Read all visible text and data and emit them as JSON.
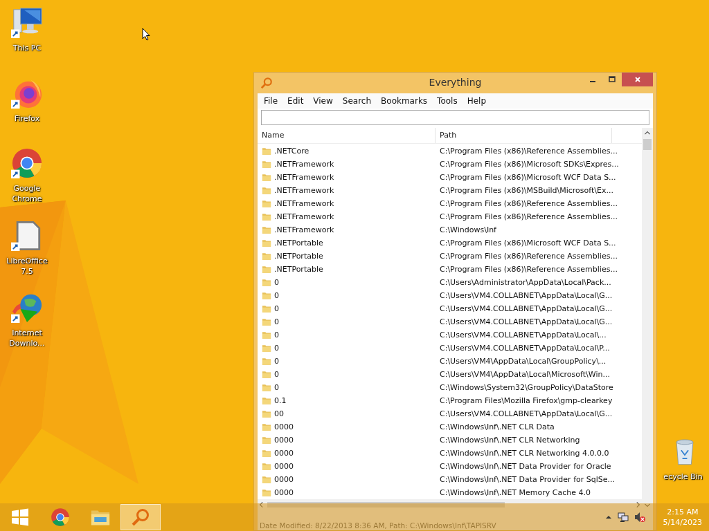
{
  "desktop_icons": [
    {
      "label": "This PC",
      "kind": "pc"
    },
    {
      "label": "Firefox",
      "kind": "firefox"
    },
    {
      "label": "Google Chrome",
      "kind": "chrome"
    },
    {
      "label": "LibreOffice 7.5",
      "kind": "libreoffice"
    },
    {
      "label": "Internet Downlo...",
      "kind": "idm"
    }
  ],
  "recycle_bin": {
    "label": "ecycle Bin"
  },
  "window": {
    "title": "Everything",
    "menu": [
      "File",
      "Edit",
      "View",
      "Search",
      "Bookmarks",
      "Tools",
      "Help"
    ],
    "columns": [
      "Name",
      "Path"
    ],
    "rows": [
      {
        "name": ".NETCore",
        "path": "C:\\Program Files (x86)\\Reference Assemblies..."
      },
      {
        "name": ".NETFramework",
        "path": "C:\\Program Files (x86)\\Microsoft SDKs\\Expres..."
      },
      {
        "name": ".NETFramework",
        "path": "C:\\Program Files (x86)\\Microsoft WCF Data S..."
      },
      {
        "name": ".NETFramework",
        "path": "C:\\Program Files (x86)\\MSBuild\\Microsoft\\Ex..."
      },
      {
        "name": ".NETFramework",
        "path": "C:\\Program Files (x86)\\Reference Assemblies..."
      },
      {
        "name": ".NETFramework",
        "path": "C:\\Program Files (x86)\\Reference Assemblies..."
      },
      {
        "name": ".NETFramework",
        "path": "C:\\Windows\\Inf"
      },
      {
        "name": ".NETPortable",
        "path": "C:\\Program Files (x86)\\Microsoft WCF Data S..."
      },
      {
        "name": ".NETPortable",
        "path": "C:\\Program Files (x86)\\Reference Assemblies..."
      },
      {
        "name": ".NETPortable",
        "path": "C:\\Program Files (x86)\\Reference Assemblies..."
      },
      {
        "name": "0",
        "path": "C:\\Users\\Administrator\\AppData\\Local\\Pack..."
      },
      {
        "name": "0",
        "path": "C:\\Users\\VM4.COLLABNET\\AppData\\Local\\G..."
      },
      {
        "name": "0",
        "path": "C:\\Users\\VM4.COLLABNET\\AppData\\Local\\G..."
      },
      {
        "name": "0",
        "path": "C:\\Users\\VM4.COLLABNET\\AppData\\Local\\G..."
      },
      {
        "name": "0",
        "path": "C:\\Users\\VM4.COLLABNET\\AppData\\Local\\..."
      },
      {
        "name": "0",
        "path": "C:\\Users\\VM4.COLLABNET\\AppData\\Local\\P..."
      },
      {
        "name": "0",
        "path": "C:\\Users\\VM4\\AppData\\Local\\GroupPolicy\\..."
      },
      {
        "name": "0",
        "path": "C:\\Users\\VM4\\AppData\\Local\\Microsoft\\Win..."
      },
      {
        "name": "0",
        "path": "C:\\Windows\\System32\\GroupPolicy\\DataStore"
      },
      {
        "name": "0.1",
        "path": "C:\\Program Files\\Mozilla Firefox\\gmp-clearkey"
      },
      {
        "name": "00",
        "path": "C:\\Users\\VM4.COLLABNET\\AppData\\Local\\G..."
      },
      {
        "name": "0000",
        "path": "C:\\Windows\\Inf\\.NET CLR Data"
      },
      {
        "name": "0000",
        "path": "C:\\Windows\\Inf\\.NET CLR Networking"
      },
      {
        "name": "0000",
        "path": "C:\\Windows\\Inf\\.NET CLR Networking 4.0.0.0"
      },
      {
        "name": "0000",
        "path": "C:\\Windows\\Inf\\.NET Data Provider for Oracle"
      },
      {
        "name": "0000",
        "path": "C:\\Windows\\Inf\\.NET Data Provider for SqlSe..."
      },
      {
        "name": "0000",
        "path": "C:\\Windows\\Inf\\.NET Memory Cache 4.0"
      }
    ],
    "status_bar": "Date Modified: 8/22/2013 8:36 AM, Path: C:\\Windows\\Inf\\TAPISRV"
  },
  "taskbar": {
    "apps": [
      {
        "kind": "start",
        "selected": false
      },
      {
        "kind": "chrome",
        "selected": false
      },
      {
        "kind": "explorer",
        "selected": false
      },
      {
        "kind": "everything",
        "selected": true
      }
    ],
    "time": "2:15 AM",
    "date": "5/14/2023"
  }
}
